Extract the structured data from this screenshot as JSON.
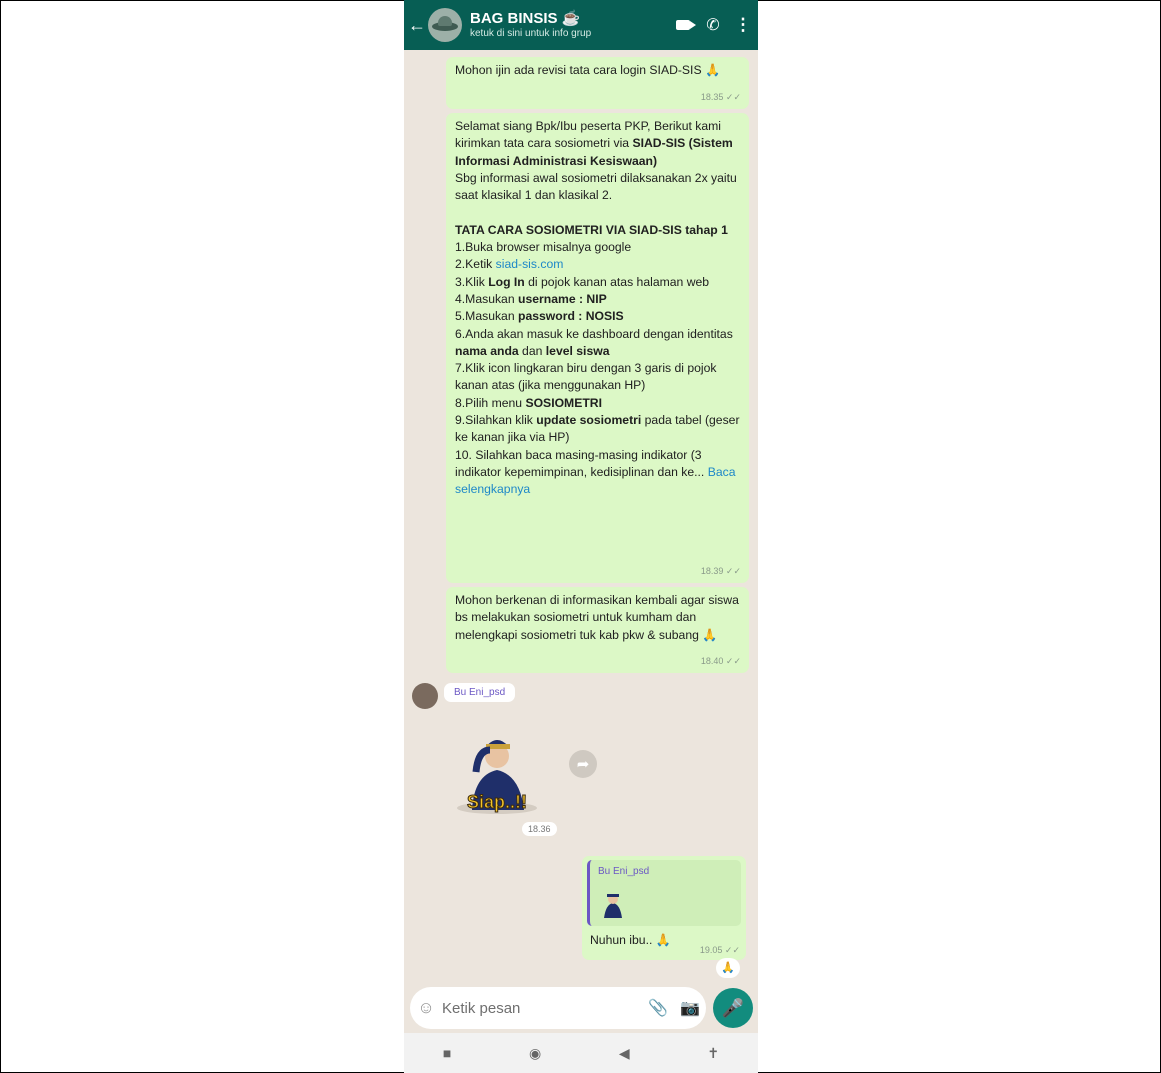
{
  "header": {
    "back_icon": "back-arrow-icon",
    "title": "BAG BINSIS ☕",
    "subtitle": "ketuk di sini untuk info grup"
  },
  "messages": [
    {
      "text": "Mohon ijin ada revisi tata cara login SIAD-SIS 🙏",
      "time": "18.35"
    },
    {
      "time": "18.39"
    },
    {
      "text": "Mohon berkenan di informasikan kembali agar siswa bs melakukan sosiometri untuk kumham dan melengkapi sosiometri tuk kab pkw & subang 🙏",
      "time": "18.40"
    }
  ],
  "msg2": {
    "p1": "Selamat siang Bpk/Ibu peserta PKP, Berikut kami kirimkan tata cara sosiometri via ",
    "p1b": "SIAD-SIS (Sistem Informasi Administrasi Kesiswaan)",
    "p2": "Sbg informasi awal sosiometri dilaksanakan 2x yaitu saat klasikal 1 dan klasikal 2.",
    "h1": "TATA CARA SOSIOMETRI VIA SIAD-SIS tahap 1",
    "s1": "1.Buka browser misalnya google",
    "s2a": "2.Ketik ",
    "s2b": "siad-sis.com",
    "s3a": "3.Klik ",
    "s3b": "Log In",
    "s3c": " di pojok kanan atas halaman web",
    "s4a": "4.Masukan ",
    "s4b": "username : NIP",
    "s5a": "5.Masukan ",
    "s5b": "password : NOSIS",
    "s6a": "6.Anda akan masuk ke dashboard dengan identitas ",
    "s6b": "nama anda",
    "s6c": " dan ",
    "s6d": "level siswa",
    "s7": "7.Klik icon lingkaran biru dengan 3 garis di pojok kanan atas (jika menggunakan HP)",
    "s8a": "8.Pilih menu ",
    "s8b": "SOSIOMETRI",
    "s9a": "9.Silahkan klik ",
    "s9b": "update sosiometri",
    "s9c": " pada tabel (geser ke kanan jika via HP)",
    "s10": "10.  Silahkan baca masing-masing indikator (3 indikator kepemimpinan, kedisiplinan dan ke... ",
    "more": "Baca selengkapnya"
  },
  "sender": {
    "name": "Bu Eni_psd"
  },
  "sticker": {
    "caption": "Siap..!!",
    "time": "18.36"
  },
  "reply": {
    "quoted_name": "Bu Eni_psd",
    "text": "Nuhun ibu.. 🙏",
    "time": "19.05"
  },
  "reaction": "🙏",
  "composer": {
    "placeholder": "Ketik pesan"
  }
}
